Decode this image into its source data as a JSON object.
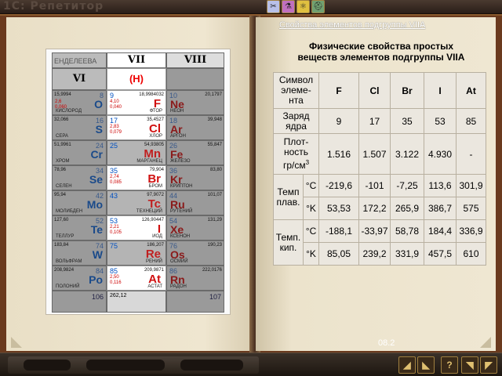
{
  "app": {
    "title": "1С: Репетитор"
  },
  "top_icons": [
    "tools-icon",
    "flask-icon",
    "atom-icon",
    "hat-icon"
  ],
  "periodic_image": {
    "groups": [
      "VI",
      "VII",
      "VIII"
    ],
    "header_text": "ЕНДЕЛЕЕВА",
    "rows": [
      {
        "left": {
          "sym": "O",
          "num": "8",
          "name": "КИСЛОРОД",
          "mass": "15,9994",
          "elec": "2,6\n0,060"
        },
        "mid": {
          "sym": "F",
          "num": "9",
          "name": "ФТОР",
          "mass": "18,9984032",
          "elec": "4,10\n0,040"
        },
        "right": {
          "sym": "Ne",
          "num": "10",
          "name": "НЕОН",
          "mass": "20,1797"
        }
      },
      {
        "left": {
          "sym": "S",
          "num": "16",
          "name": "СЕРА",
          "mass": "32,066"
        },
        "mid": {
          "sym": "Cl",
          "num": "17",
          "name": "ХЛОР",
          "mass": "35,4527",
          "elec": "2,83\n0,079"
        },
        "right": {
          "sym": "Ar",
          "num": "18",
          "name": "АРГОН",
          "mass": "39,948"
        }
      },
      {
        "left": {
          "sym": "Cr",
          "num": "24",
          "name": "ХРОМ",
          "mass": "51,9961"
        },
        "mid": {
          "sym": "Mn",
          "num": "25",
          "name": "МАРГАНЕЦ",
          "mass": "54,93805"
        },
        "right": {
          "sym": "Fe",
          "num": "26",
          "name": "ЖЕЛЕЗО",
          "mass": "55,847"
        }
      },
      {
        "left": {
          "sym": "Se",
          "num": "34",
          "name": "СЕЛЕН",
          "mass": "78,96"
        },
        "mid": {
          "sym": "Br",
          "num": "35",
          "name": "БРОМ",
          "mass": "79,904",
          "elec": "2,74\n0,085"
        },
        "right": {
          "sym": "Kr",
          "num": "36",
          "name": "КРИПТОН",
          "mass": "83,80"
        }
      },
      {
        "left": {
          "sym": "Mo",
          "num": "42",
          "name": "МОЛИБДЕН",
          "mass": "95,94"
        },
        "mid": {
          "sym": "Tc",
          "num": "43",
          "name": "ТЕХНЕЦИЙ",
          "mass": "97,9072"
        },
        "right": {
          "sym": "Ru",
          "num": "44",
          "name": "РУТЕНИЙ",
          "mass": "101,07"
        }
      },
      {
        "left": {
          "sym": "Te",
          "num": "52",
          "name": "ТЕЛЛУР",
          "mass": "127,60"
        },
        "mid": {
          "sym": "I",
          "num": "53",
          "name": "ИОД",
          "mass": "126,90447",
          "elec": "2,21\n0,105"
        },
        "right": {
          "sym": "Xe",
          "num": "54",
          "name": "КСЕНОН",
          "mass": "131,29"
        }
      },
      {
        "left": {
          "sym": "W",
          "num": "74",
          "name": "ВОЛЬФРАМ",
          "mass": "183,84"
        },
        "mid": {
          "sym": "Re",
          "num": "75",
          "name": "РЕНИЙ",
          "mass": "186,207"
        },
        "right": {
          "sym": "Os",
          "num": "76",
          "name": "ОСМИЙ",
          "mass": "190,23"
        }
      },
      {
        "left": {
          "sym": "Po",
          "num": "84",
          "name": "ПОЛОНИЙ",
          "mass": "208,9824"
        },
        "mid": {
          "sym": "At",
          "num": "85",
          "name": "АСТАТ",
          "mass": "209,9871",
          "elec": "2,50\n0,116"
        },
        "right": {
          "sym": "Rn",
          "num": "86",
          "name": "РАДОН",
          "mass": "222,0176"
        }
      }
    ],
    "top_mid_sym": "(H)",
    "bottom_row": {
      "left": "106",
      "mid": "262,12",
      "right": "107"
    }
  },
  "right_page": {
    "link_title": "Свойства элементов подгруппы VIIA",
    "heading_line1": "Физические свойства простых",
    "heading_line2": "веществ элементов подгруппы VIIA",
    "table": {
      "sym_label": [
        "Символ",
        "элеме-",
        "нта"
      ],
      "symbols": [
        "F",
        "Cl",
        "Br",
        "I",
        "At"
      ],
      "charge_label": [
        "Заряд",
        "ядра"
      ],
      "charges": [
        "9",
        "17",
        "35",
        "53",
        "85"
      ],
      "density_label": [
        "Плот-",
        "ность",
        "гр/см"
      ],
      "density_sup": "3",
      "densities": [
        "1.516",
        "1.507",
        "3.122",
        "4.930",
        "-"
      ],
      "melt_label": [
        "Темп",
        "плав."
      ],
      "boil_label": [
        "Темп.",
        "кип."
      ],
      "unit_c": "°C",
      "unit_k": "°K",
      "melt_c": [
        "-219,6",
        "-101",
        "-7,25",
        "113,6",
        "301,9"
      ],
      "melt_k": [
        "53,53",
        "172,2",
        "265,9",
        "386,7",
        "575"
      ],
      "boil_c": [
        "-188,1",
        "-33,97",
        "58,78",
        "184,4",
        "336,9"
      ],
      "boil_k": [
        "85,05",
        "239,2",
        "331,9",
        "457,5",
        "610"
      ]
    },
    "page_number": "08.2"
  },
  "bottom_bar": {
    "buttons": [
      "◢",
      "◣",
      "?",
      "◥",
      "◤"
    ]
  }
}
